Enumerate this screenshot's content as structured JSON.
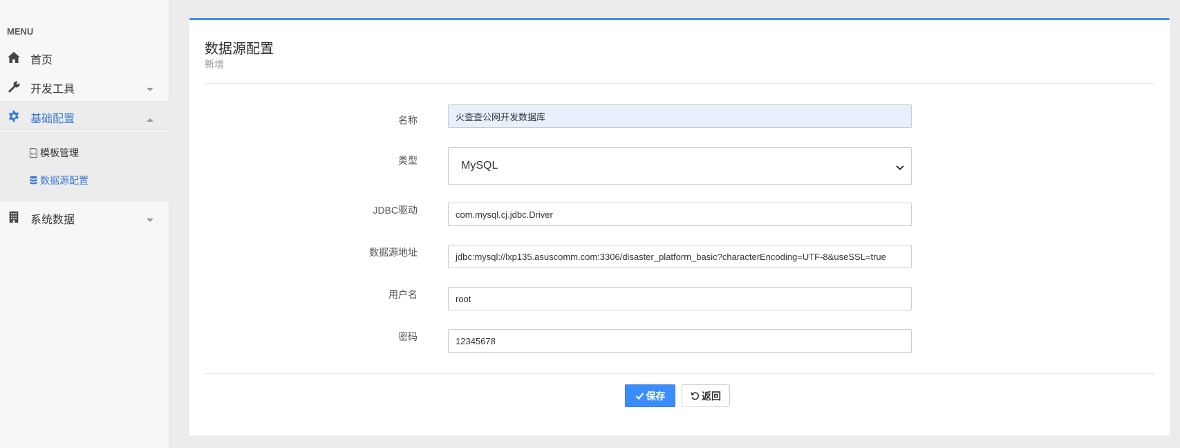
{
  "sidebar": {
    "menu_label": "MENU",
    "items": [
      {
        "label": "首页",
        "icon": "home-icon"
      },
      {
        "label": "开发工具",
        "icon": "wrench-icon"
      },
      {
        "label": "基础配置",
        "icon": "gear-icon"
      },
      {
        "label": "系统数据",
        "icon": "building-icon"
      }
    ],
    "subitems": [
      {
        "label": "模板管理",
        "icon": "file-code-icon"
      },
      {
        "label": "数据源配置",
        "icon": "database-icon"
      }
    ]
  },
  "panel": {
    "title": "数据源配置",
    "subtitle": "新增"
  },
  "form": {
    "name_label": "名称",
    "name_value": "火查查公网开发数据库",
    "type_label": "类型",
    "type_value": "MySQL",
    "driver_label": "JDBC驱动",
    "driver_value": "com.mysql.cj.jdbc.Driver",
    "url_label": "数据源地址",
    "url_value": "jdbc:mysql://lxp135.asuscomm.com:3306/disaster_platform_basic?characterEncoding=UTF-8&useSSL=true",
    "user_label": "用户名",
    "user_value": "root",
    "password_label": "密码",
    "password_value": "12345678"
  },
  "actions": {
    "save_label": "保存",
    "back_label": "返回"
  },
  "colors": {
    "accent": "#3c8dfc",
    "active_text": "#3a7bd5",
    "autofill_bg": "#e8f0fe"
  }
}
